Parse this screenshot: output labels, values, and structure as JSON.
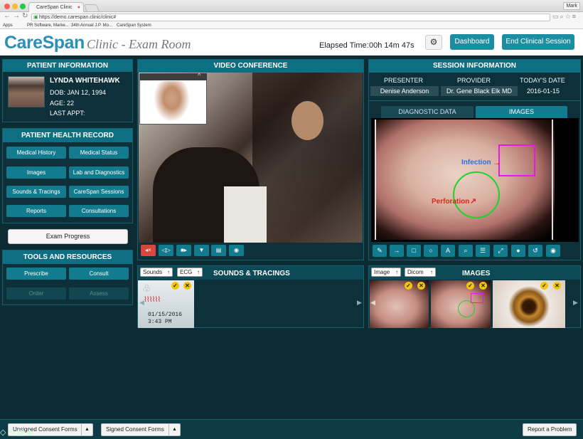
{
  "browser": {
    "tab_title": "CareSpan Clinic",
    "url": "https://demo.carespan.clinic/clinic#",
    "user": "Mark",
    "bookmarks": [
      "Apps",
      "PR Software, Marke...",
      "34th Annual J.P. Mo...",
      "CareSpan System"
    ]
  },
  "header": {
    "brand": "CareSpan",
    "subtitle": "Clinic - Exam Room",
    "elapsed_label": "Elapsed Time:",
    "elapsed_value": "00h 14m 47s",
    "dashboard_label": "Dashboard",
    "end_session_label": "End Clinical Session"
  },
  "patient": {
    "title": "PATIENT INFORMATION",
    "name": "LYNDA WHITEHAWK",
    "dob": "DOB: JAN 12, 1994",
    "age": "AGE: 22",
    "last_appt": "LAST APPT:"
  },
  "health_record": {
    "title": "PATIENT HEALTH RECORD",
    "buttons": [
      "Medical History",
      "Medical Status",
      "Images",
      "Lab and Diagnostics",
      "Sounds & Tracings",
      "CareSpan Sessions",
      "Reports",
      "Consultations"
    ]
  },
  "exam_progress_label": "Exam Progress",
  "tools": {
    "title": "TOOLS AND RESOURCES",
    "buttons": [
      "Prescribe",
      "Consult",
      "Order",
      "Assess"
    ]
  },
  "video": {
    "title": "VIDEO CONFERENCE",
    "controls": [
      "mute-icon",
      "audio-icon",
      "camera-icon",
      "pin-icon",
      "record-icon",
      "snapshot-icon"
    ]
  },
  "session": {
    "title": "SESSION INFORMATION",
    "presenter_label": "PRESENTER",
    "presenter": "Denise Anderson",
    "provider_label": "PROVIDER",
    "provider": "Dr. Gene Black Elk MD",
    "date_label": "TODAY'S DATE",
    "date": "2016-01-15",
    "tab_diagnostic": "DIAGNOSTIC DATA",
    "tab_images": "IMAGES",
    "annotation_infection": "Infection",
    "annotation_perforation": "Perforation"
  },
  "sounds": {
    "title": "SOUNDS & TRACINGS",
    "filter1": "Sounds",
    "filter2": "ECG",
    "item_date": "01/15/2016",
    "item_time": "3:43 PM"
  },
  "images": {
    "title": "IMAGES",
    "filter1": "Image",
    "filter2": "Dicom"
  },
  "footer": {
    "unsigned": "Unsigned Consent Forms",
    "signed": "Signed Consent Forms",
    "report": "Report a Problem"
  }
}
